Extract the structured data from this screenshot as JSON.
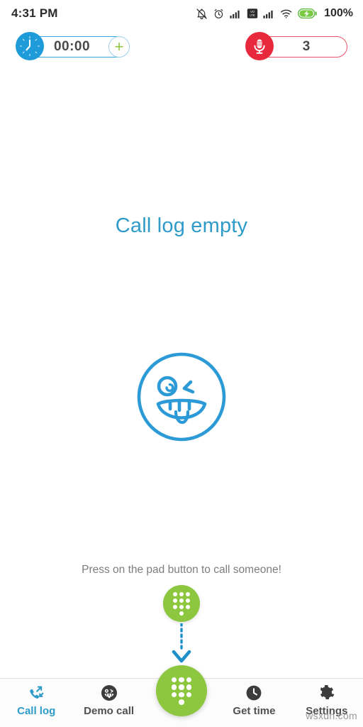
{
  "status_bar": {
    "time": "4:31 PM",
    "battery_percent": "100%",
    "icons": [
      "bell-muted-icon",
      "alarm-clock-icon",
      "signal-bars-icon",
      "volte-icon",
      "signal-bars-2-icon",
      "wifi-icon",
      "battery-charging-icon"
    ]
  },
  "toolbar": {
    "timer": {
      "icon": "clock-icon",
      "value": "00:00",
      "add_label": "+",
      "accent": "#1f9bd9"
    },
    "recorder": {
      "icon": "microphone-icon",
      "value": "3",
      "accent": "#e8283c"
    }
  },
  "main": {
    "empty_title": "Call log empty",
    "empty_illustration": "winking-face-tongue-icon",
    "hint_text": "Press on the pad button to call someone!",
    "pad_button_icon": "dialpad-icon",
    "arrow_icon": "arrow-down-icon",
    "title_color": "#2e9bc9",
    "accent_green": "#8dc63f"
  },
  "bottom_nav": {
    "items": [
      {
        "label": "Call log",
        "icon": "call-log-icon",
        "active": true
      },
      {
        "label": "Demo call",
        "icon": "demo-face-icon",
        "active": false
      },
      {
        "label": "Get time",
        "icon": "clock-filled-icon",
        "active": false
      },
      {
        "label": "Settings",
        "icon": "gear-icon",
        "active": false
      }
    ],
    "fab_icon": "dialpad-icon"
  },
  "watermark": "wsxdn.com"
}
